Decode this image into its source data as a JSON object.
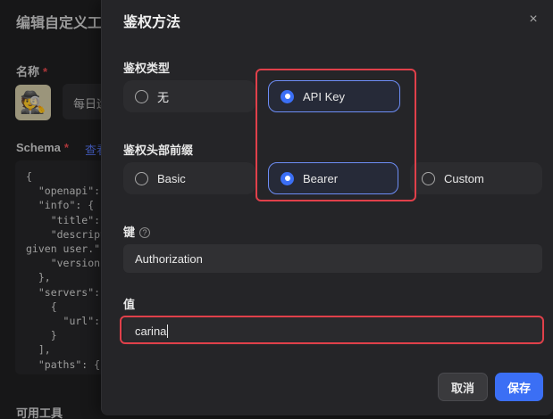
{
  "background": {
    "title": "编辑自定义工",
    "name_label": "名称",
    "required_mark": "*",
    "name_value": "每日运",
    "avatar_emoji": "🕵",
    "schema_label": "Schema",
    "view_link": "查看",
    "tools_label": "可用工具",
    "code_lines": [
      "{",
      "  \"openapi\": \"",
      "  \"info\": {",
      "    \"title\": \"For",
      "    \"descriptio",
      "given user.\",",
      "    \"version\": \"",
      "  },",
      "  \"servers\": [",
      "    {",
      "      \"url\": \"http",
      "    }",
      "  ],",
      "  \"paths\": {",
      "    \"/..."
    ]
  },
  "modal": {
    "title": "鉴权方法",
    "close_glyph": "×",
    "auth_type_label": "鉴权类型",
    "auth_types": [
      {
        "label": "无",
        "selected": false
      },
      {
        "label": "API Key",
        "selected": true
      }
    ],
    "header_prefix_label": "鉴权头部前缀",
    "prefixes": [
      {
        "label": "Basic",
        "selected": false
      },
      {
        "label": "Bearer",
        "selected": true
      },
      {
        "label": "Custom",
        "selected": false
      }
    ],
    "key_label": "键",
    "help_glyph": "?",
    "key_value": "Authorization",
    "value_label": "值",
    "value_value": "carina",
    "cancel_label": "取消",
    "save_label": "保存"
  },
  "colors": {
    "accent": "#3b6ff5",
    "highlight": "#e0404a"
  }
}
